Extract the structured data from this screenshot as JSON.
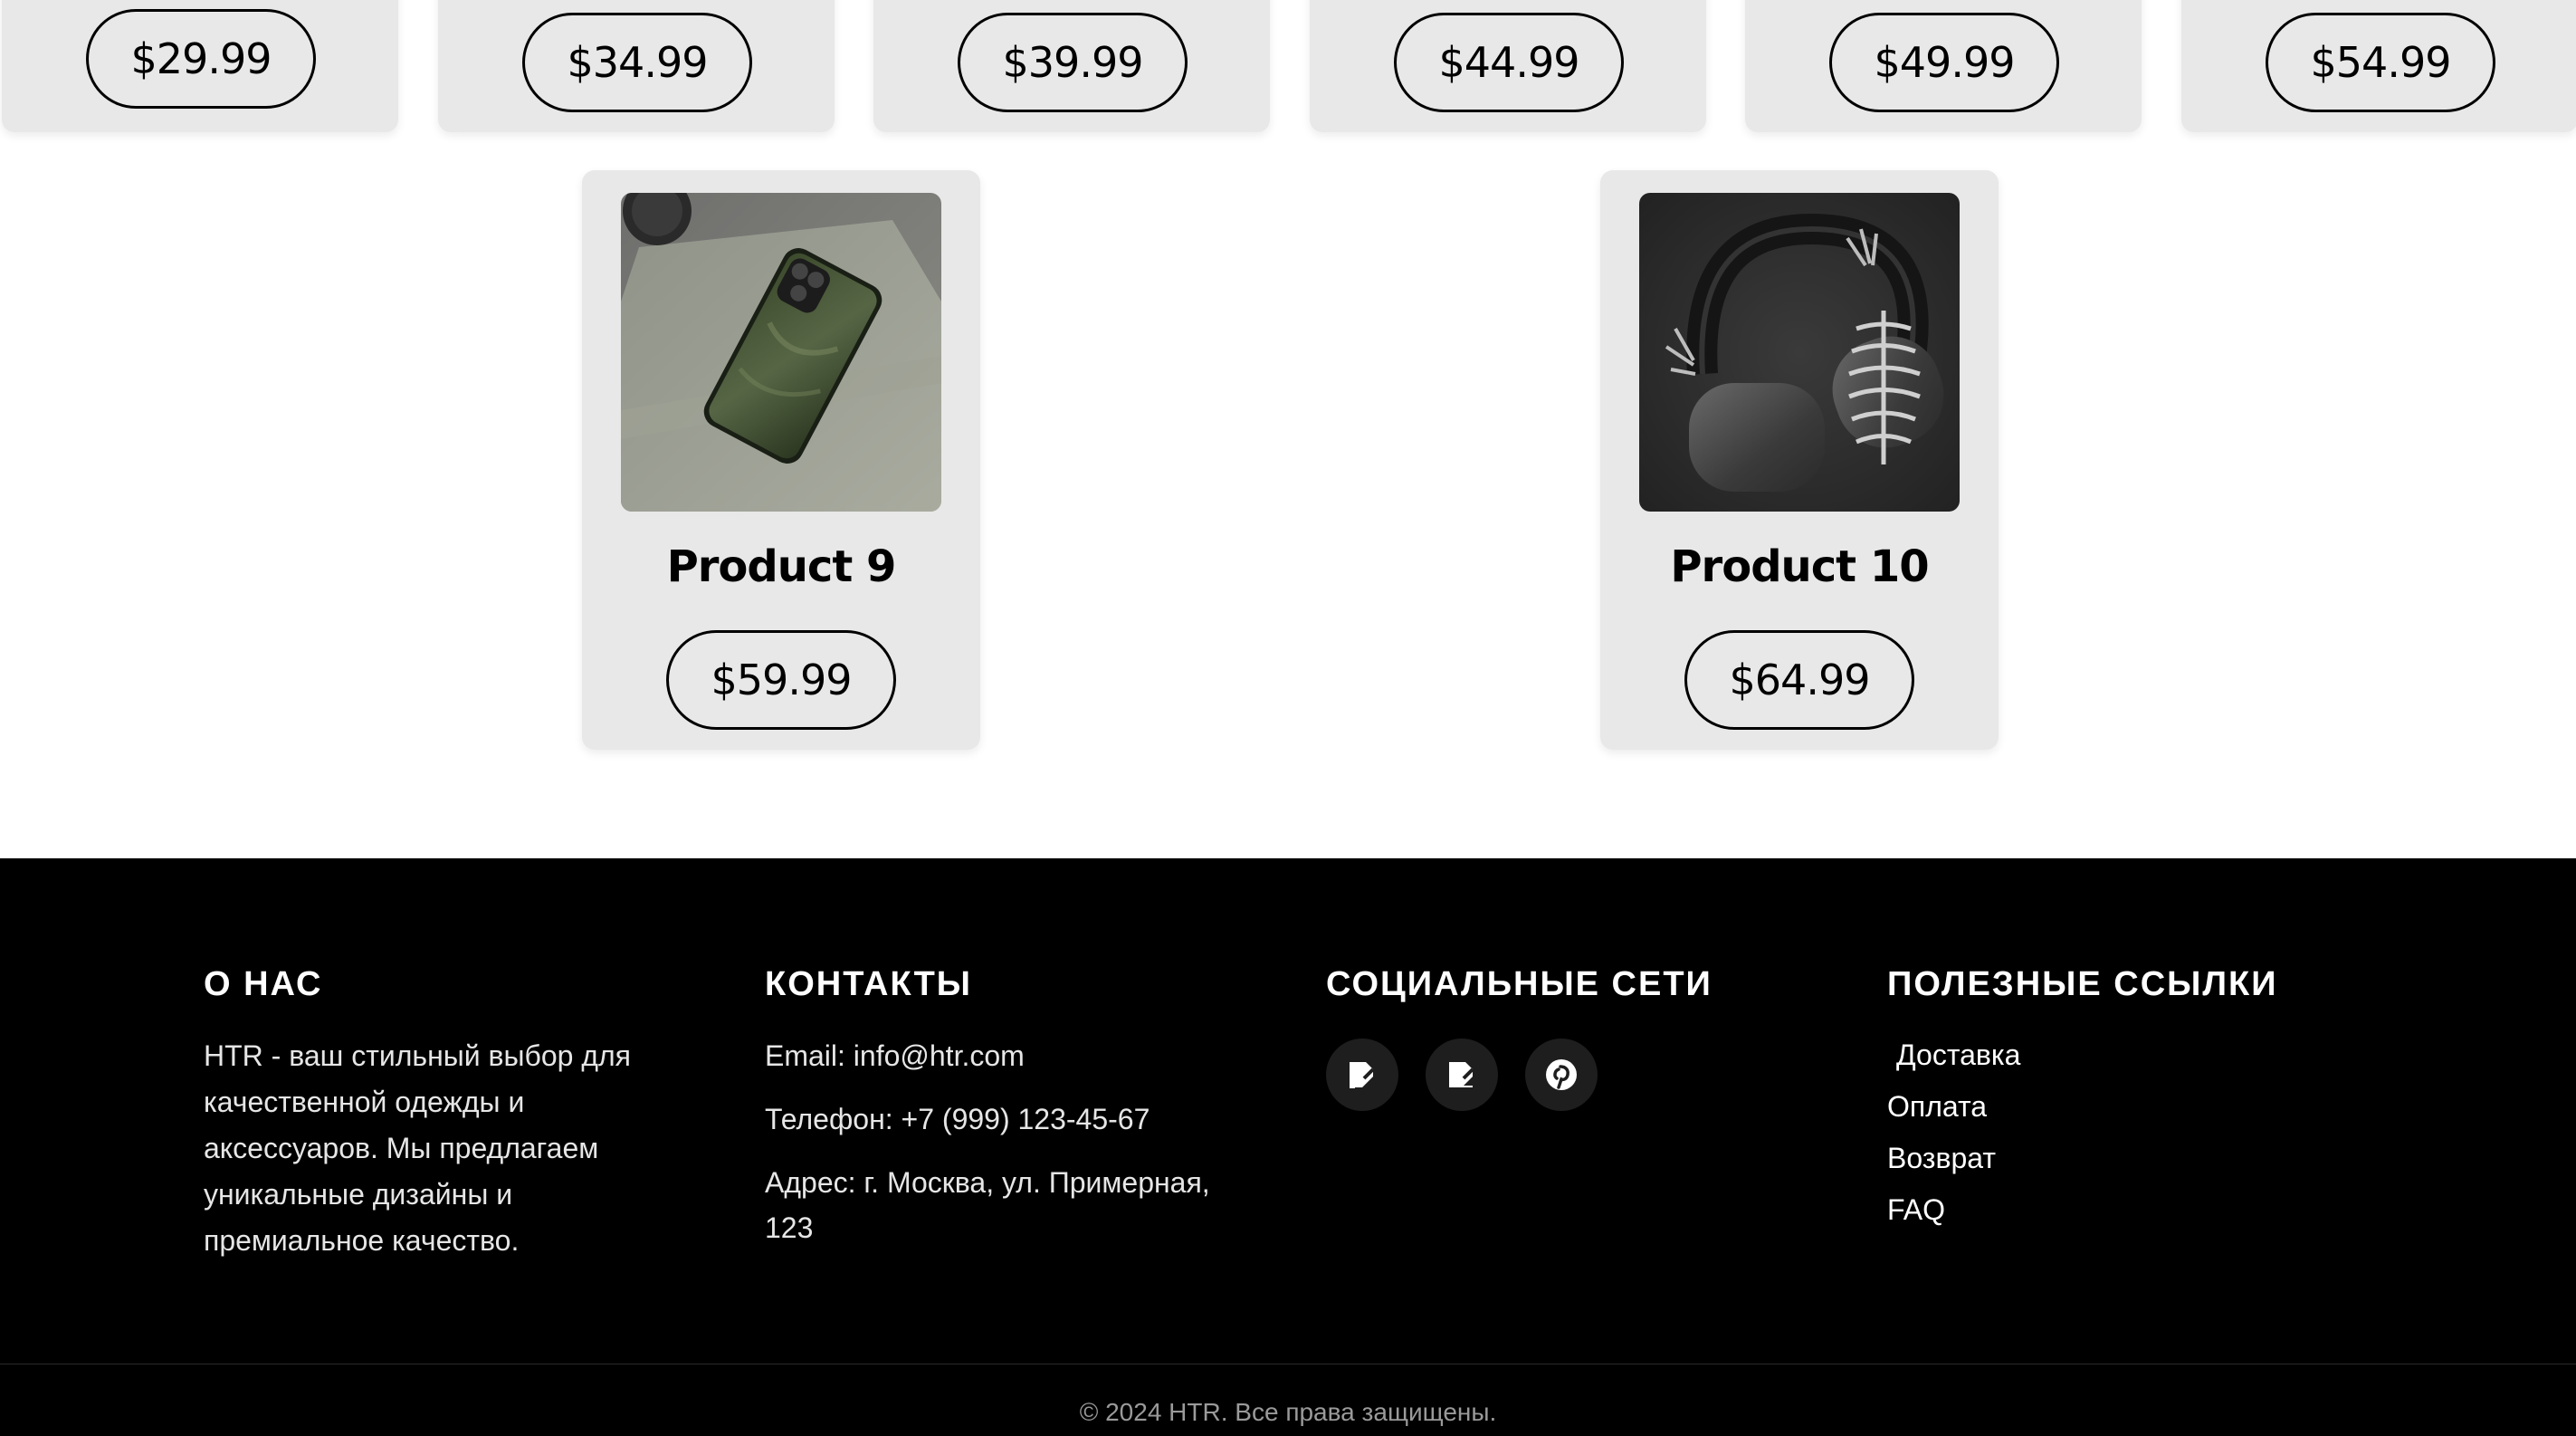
{
  "top_row": [
    {
      "price": "$29.99"
    },
    {
      "price": "$34.99"
    },
    {
      "price": "$39.99"
    },
    {
      "price": "$44.99"
    },
    {
      "price": "$49.99"
    },
    {
      "price": "$54.99"
    }
  ],
  "products": [
    {
      "name": "Product 9",
      "price": "$59.99",
      "image": "green-phone-case"
    },
    {
      "name": "Product 10",
      "price": "$64.99",
      "image": "headphones-with-skeleton-decor"
    }
  ],
  "footer": {
    "about": {
      "title": "О НАС",
      "text": "HTR - ваш стильный выбор для качественной одежды и аксессуаров. Мы предлагаем уникальные дизайны и премиальное качество."
    },
    "contacts": {
      "title": "КОНТАКТЫ",
      "email": "Email: info@htr.com",
      "phone": "Телефон: +7 (999) 123-45-67",
      "address": "Адрес: г. Москва, ул. Примерная, 123"
    },
    "social": {
      "title": "СОЦИАЛЬНЫЕ СЕТИ",
      "icons": [
        "vk-icon",
        "telegram-icon",
        "pinterest-icon"
      ]
    },
    "links": {
      "title": "ПОЛЕЗНЫЕ ССЫЛКИ",
      "items": [
        "Доставка",
        "Оплата",
        "Возврат",
        "FAQ"
      ]
    },
    "copyright": "© 2024 HTR. Все права защищены."
  }
}
